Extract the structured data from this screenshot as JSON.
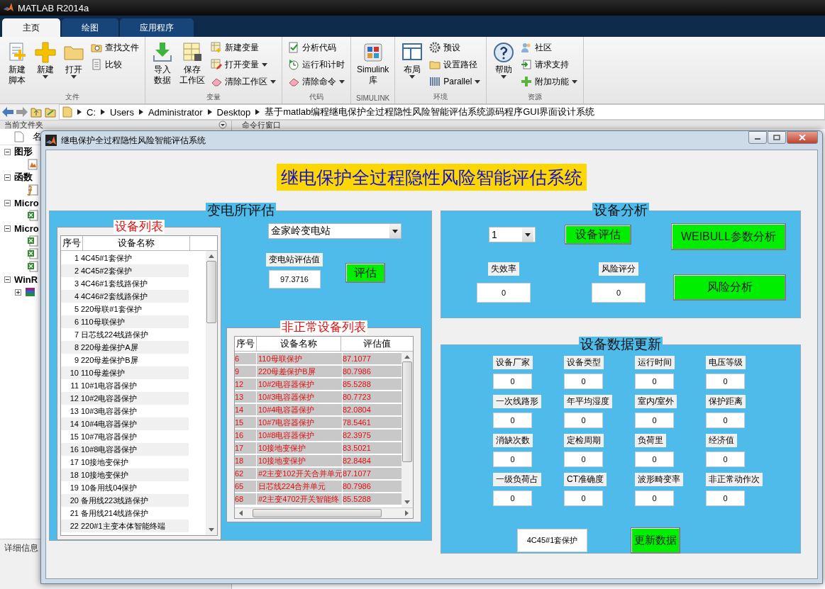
{
  "app_window": {
    "title": "MATLAB R2014a"
  },
  "tabs": [
    {
      "label": "主页",
      "selected": true
    },
    {
      "label": "绘图",
      "selected": false
    },
    {
      "label": "应用程序",
      "selected": false
    }
  ],
  "toolstrip": [
    {
      "label": "文件",
      "large": [
        {
          "lines": [
            "新建",
            "脚本"
          ],
          "dropdown": false
        },
        {
          "lines": [
            "新建"
          ],
          "dropdown": true
        },
        {
          "lines": [
            "打开"
          ],
          "dropdown": true
        }
      ],
      "small": [
        {
          "label": "查找文件",
          "dropdown": false
        },
        {
          "label": "比较",
          "dropdown": false
        }
      ]
    },
    {
      "label": "变量",
      "large": [
        {
          "lines": [
            "导入",
            "数据"
          ],
          "dropdown": false
        },
        {
          "lines": [
            "保存",
            "工作区"
          ],
          "dropdown": false
        }
      ],
      "small": [
        {
          "label": "新建变量",
          "dropdown": false
        },
        {
          "label": "打开变量",
          "dropdown": true
        },
        {
          "label": "清除工作区",
          "dropdown": true
        }
      ]
    },
    {
      "label": "代码",
      "small": [
        {
          "label": "分析代码",
          "dropdown": false
        },
        {
          "label": "运行和计时",
          "dropdown": false
        },
        {
          "label": "清除命令",
          "dropdown": true
        }
      ]
    },
    {
      "label": "SIMULINK",
      "large": [
        {
          "lines": [
            "Simulink",
            "库"
          ],
          "dropdown": false
        }
      ]
    },
    {
      "label": "环境",
      "large": [
        {
          "lines": [
            "布局"
          ],
          "dropdown": true
        }
      ],
      "small": [
        {
          "label": "预设",
          "dropdown": false
        },
        {
          "label": "设置路径",
          "dropdown": false
        },
        {
          "label": "Parallel",
          "dropdown": true
        }
      ]
    },
    {
      "label": "资源",
      "large": [
        {
          "lines": [
            "帮助"
          ],
          "dropdown": true
        }
      ],
      "small": [
        {
          "label": "社区",
          "dropdown": false
        },
        {
          "label": "请求支持",
          "dropdown": false
        },
        {
          "label": "附加功能",
          "dropdown": true
        }
      ]
    }
  ],
  "path": [
    "C:",
    "Users",
    "Administrator",
    "Desktop",
    "基于matlab编程继电保护全过程隐性风险智能评估系统源码程序GUI界面设计系统"
  ],
  "file_panel": {
    "title": "当前文件夹",
    "column": "名",
    "groups": [
      {
        "label": "图形",
        "expanded": true,
        "children": [
          {
            "kind": "figure"
          }
        ]
      },
      {
        "label": "函数",
        "expanded": true,
        "children": [
          {
            "kind": "function"
          }
        ]
      },
      {
        "label": "Micro",
        "expanded": true,
        "children": [
          {
            "kind": "spreadsheet"
          }
        ]
      },
      {
        "label": "Micro",
        "expanded": true,
        "children": [
          {
            "kind": "spreadsheet"
          },
          {
            "kind": "spreadsheet"
          },
          {
            "kind": "spreadsheet"
          }
        ]
      },
      {
        "label": "WinR",
        "expanded": true,
        "children": [
          {
            "kind": "archive",
            "expanded": false
          }
        ]
      }
    ],
    "details_title": "详细信息"
  },
  "command_window": {
    "title": "命令行窗口"
  },
  "figure": {
    "title": "继电保护全过程隐性风险智能评估系统",
    "heading": "继电保护全过程隐性风险智能评估系统",
    "substation_panel": {
      "title": "变电所评估",
      "device_list": {
        "title": "设备列表",
        "columns": [
          "序号",
          "设备名称"
        ],
        "rows": [
          [
            "1",
            "4C45#1套保护"
          ],
          [
            "2",
            "4C45#2套保护"
          ],
          [
            "3",
            "4C46#1套线路保护"
          ],
          [
            "4",
            "4C46#2套线路保护"
          ],
          [
            "5",
            "220母联#1套保护"
          ],
          [
            "6",
            "110母联保护"
          ],
          [
            "7",
            "日芯线224线路保护"
          ],
          [
            "8",
            "220母差保护A屏"
          ],
          [
            "9",
            "220母差保护B屏"
          ],
          [
            "10",
            "110母差保护"
          ],
          [
            "11",
            "10#1电容器保护"
          ],
          [
            "12",
            "10#2电容器保护"
          ],
          [
            "13",
            "10#3电容器保护"
          ],
          [
            "14",
            "10#4电容器保护"
          ],
          [
            "15",
            "10#7电容器保护"
          ],
          [
            "16",
            "10#8电容器保护"
          ],
          [
            "17",
            "10接地变保护"
          ],
          [
            "18",
            "10接地变保护"
          ],
          [
            "19",
            "10备用线04保护"
          ],
          [
            "20",
            "备用线223线路保护"
          ],
          [
            "21",
            "备用线214线路保护"
          ],
          [
            "22",
            "220#1主变本体智能终端"
          ]
        ]
      },
      "station_select": {
        "value": "金家岭变电站"
      },
      "score_label": "变电站评估值",
      "score_value": "97.3716",
      "evaluate_button": "评估",
      "abnormal_list": {
        "title": "非正常设备列表",
        "columns": [
          "序号",
          "设备名称",
          "评估值"
        ],
        "rows": [
          [
            "6",
            "110母联保护",
            "87.1077"
          ],
          [
            "9",
            "220母差保护B屏",
            "80.7986"
          ],
          [
            "12",
            "10#2电容器保护",
            "85.5288"
          ],
          [
            "13",
            "10#3电容器保护",
            "80.7723"
          ],
          [
            "14",
            "10#4电容器保护",
            "82.0804"
          ],
          [
            "15",
            "10#7电容器保护",
            "78.5461"
          ],
          [
            "16",
            "10#8电容器保护",
            "82.3975"
          ],
          [
            "17",
            "10接地变保护",
            "83.5021"
          ],
          [
            "18",
            "10接地变保护",
            "82.8484"
          ],
          [
            "62",
            "#2主变102开关合并单元",
            "87.1077"
          ],
          [
            "65",
            "日芯线224合并单元",
            "80.7986"
          ],
          [
            "68",
            "#2主变4702开关智能终",
            "85.5288"
          ]
        ]
      }
    },
    "analysis_panel": {
      "title": "设备分析",
      "device_select": {
        "value": "1"
      },
      "evaluate_button": "设备评估",
      "weibull_button": "WEIBULL参数分析",
      "metrics": [
        {
          "label": "失效率",
          "value": "0"
        },
        {
          "label": "风险评分",
          "value": "0"
        }
      ],
      "risk_button": "风险分析"
    },
    "update_panel": {
      "title": "设备数据更新",
      "fields": [
        {
          "label": "设备厂家",
          "value": "0"
        },
        {
          "label": "设备类型",
          "value": "0"
        },
        {
          "label": "运行时间",
          "value": "0"
        },
        {
          "label": "电压等级",
          "value": "0"
        },
        {
          "label": "一次线路形",
          "value": "0"
        },
        {
          "label": "年平均湿度",
          "value": "0"
        },
        {
          "label": "室内/室外",
          "value": "0"
        },
        {
          "label": "保护距离",
          "value": "0"
        },
        {
          "label": "消缺次数",
          "value": "0"
        },
        {
          "label": "定检周期",
          "value": "0"
        },
        {
          "label": "负荷里",
          "value": "0"
        },
        {
          "label": "经济值",
          "value": "0"
        },
        {
          "label": "一级负荷占",
          "value": "0"
        },
        {
          "label": "CT准确度",
          "value": "0"
        },
        {
          "label": "波形畸变率",
          "value": "0"
        },
        {
          "label": "非正常动作次",
          "value": "0"
        }
      ],
      "device_name": "4C45#1套保护",
      "update_button": "更新数据"
    }
  }
}
